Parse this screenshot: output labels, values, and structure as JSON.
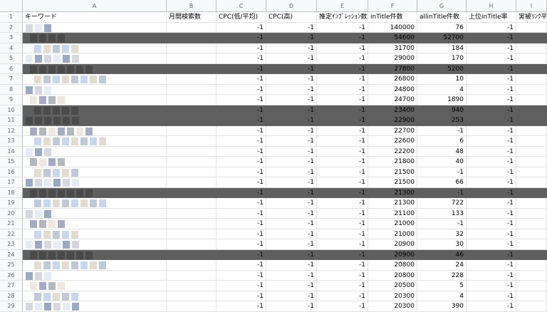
{
  "columns": [
    "A",
    "B",
    "C",
    "D",
    "E",
    "F",
    "G",
    "H",
    "I"
  ],
  "headers": [
    "キーワード",
    "月間検索数",
    "CPC(低/平均)",
    "CPC(高)",
    "推定ｲﾝﾌﾟﾚｯｼｮﾝ数",
    "inTitle件数",
    "allinTitle件数",
    "上位inTitle率",
    "実被ﾘﾝｸ平"
  ],
  "rows": [
    {
      "num": "2",
      "dark": false,
      "c": "-1",
      "d": "-1",
      "e": "-1",
      "f": "140000",
      "g": "76",
      "h": "-1"
    },
    {
      "num": "3",
      "dark": true,
      "c": "-1",
      "d": "-1",
      "e": "-1",
      "f": "54600",
      "g": "52700",
      "h": "-1"
    },
    {
      "num": "4",
      "dark": false,
      "c": "-1",
      "d": "-1",
      "e": "-1",
      "f": "31700",
      "g": "184",
      "h": "-1"
    },
    {
      "num": "5",
      "dark": false,
      "c": "-1",
      "d": "-1",
      "e": "-1",
      "f": "29000",
      "g": "170",
      "h": "-1"
    },
    {
      "num": "6",
      "dark": true,
      "c": "-1",
      "d": "-1",
      "e": "-1",
      "f": "27800",
      "g": "5200",
      "h": "-1"
    },
    {
      "num": "7",
      "dark": false,
      "c": "-1",
      "d": "-1",
      "e": "-1",
      "f": "26800",
      "g": "10",
      "h": "-1"
    },
    {
      "num": "8",
      "dark": false,
      "c": "-1",
      "d": "-1",
      "e": "-1",
      "f": "24800",
      "g": "4",
      "h": "-1"
    },
    {
      "num": "9",
      "dark": false,
      "c": "-1",
      "d": "-1",
      "e": "-1",
      "f": "24700",
      "g": "1890",
      "h": "-1"
    },
    {
      "num": "10",
      "dark": true,
      "c": "-1",
      "d": "-1",
      "e": "-1",
      "f": "23400",
      "g": "940",
      "h": "-1"
    },
    {
      "num": "11",
      "dark": true,
      "c": "-1",
      "d": "-1",
      "e": "-1",
      "f": "22900",
      "g": "253",
      "h": "-1"
    },
    {
      "num": "12",
      "dark": false,
      "c": "-1",
      "d": "-1",
      "e": "-1",
      "f": "22700",
      "g": "-1",
      "h": "-1"
    },
    {
      "num": "13",
      "dark": false,
      "c": "-1",
      "d": "-1",
      "e": "-1",
      "f": "22600",
      "g": "6",
      "h": "-1"
    },
    {
      "num": "14",
      "dark": false,
      "c": "-1",
      "d": "-1",
      "e": "-1",
      "f": "22200",
      "g": "48",
      "h": "-1"
    },
    {
      "num": "15",
      "dark": false,
      "c": "-1",
      "d": "-1",
      "e": "-1",
      "f": "21800",
      "g": "40",
      "h": "-1"
    },
    {
      "num": "16",
      "dark": false,
      "c": "-1",
      "d": "-1",
      "e": "-1",
      "f": "21500",
      "g": "-1",
      "h": "-1"
    },
    {
      "num": "17",
      "dark": false,
      "c": "-1",
      "d": "-1",
      "e": "-1",
      "f": "21500",
      "g": "66",
      "h": "-1"
    },
    {
      "num": "18",
      "dark": true,
      "c": "-1",
      "d": "-1",
      "e": "-1",
      "f": "21300",
      "g": "-1",
      "h": "-1"
    },
    {
      "num": "19",
      "dark": false,
      "c": "-1",
      "d": "-1",
      "e": "-1",
      "f": "21300",
      "g": "722",
      "h": "-1"
    },
    {
      "num": "20",
      "dark": false,
      "c": "-1",
      "d": "-1",
      "e": "-1",
      "f": "21100",
      "g": "133",
      "h": "-1"
    },
    {
      "num": "21",
      "dark": false,
      "c": "-1",
      "d": "-1",
      "e": "-1",
      "f": "21000",
      "g": "-1",
      "h": "-1"
    },
    {
      "num": "22",
      "dark": false,
      "c": "-1",
      "d": "-1",
      "e": "-1",
      "f": "21000",
      "g": "32",
      "h": "-1"
    },
    {
      "num": "23",
      "dark": false,
      "c": "-1",
      "d": "-1",
      "e": "-1",
      "f": "20900",
      "g": "30",
      "h": "-1"
    },
    {
      "num": "24",
      "dark": true,
      "c": "-1",
      "d": "-1",
      "e": "-1",
      "f": "20900",
      "g": "46",
      "h": "-1"
    },
    {
      "num": "25",
      "dark": false,
      "c": "-1",
      "d": "-1",
      "e": "-1",
      "f": "20800",
      "g": "24",
      "h": "-1"
    },
    {
      "num": "26",
      "dark": false,
      "c": "-1",
      "d": "-1",
      "e": "-1",
      "f": "20800",
      "g": "228",
      "h": "-1"
    },
    {
      "num": "27",
      "dark": false,
      "c": "-1",
      "d": "-1",
      "e": "-1",
      "f": "20500",
      "g": "5",
      "h": "-1"
    },
    {
      "num": "28",
      "dark": false,
      "c": "-1",
      "d": "-1",
      "e": "-1",
      "f": "20300",
      "g": "4",
      "h": "-1"
    },
    {
      "num": "29",
      "dark": false,
      "c": "-1",
      "d": "-1",
      "e": "-1",
      "f": "20300",
      "g": "390",
      "h": "-1"
    }
  ],
  "header_row_num": "1",
  "colors": {
    "dark_row": "#5f5f5f",
    "header_bg": "#f8f9fa",
    "grid": "#e2e2e2"
  }
}
